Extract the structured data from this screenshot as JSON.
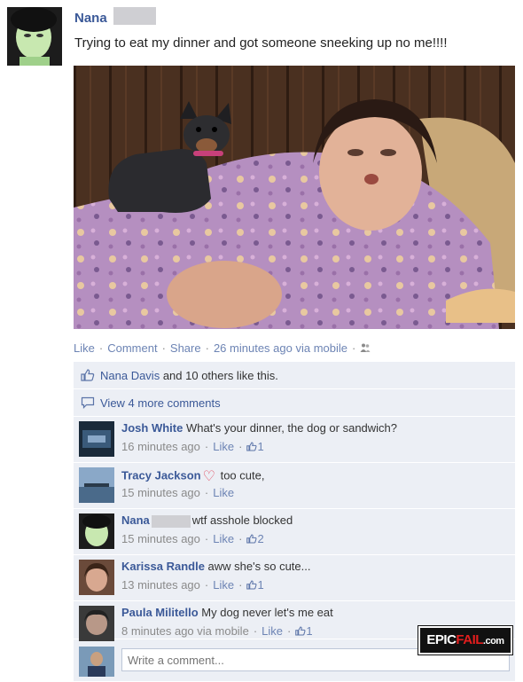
{
  "post": {
    "author": "Nana",
    "text": "Trying to eat my dinner and got someone sneeking up no me!!!!"
  },
  "actions": {
    "like": "Like",
    "comment": "Comment",
    "share": "Share",
    "time": "26 minutes ago via mobile",
    "separator": "·"
  },
  "likes": {
    "first": "Nana Davis",
    "rest": " and 10 others like this."
  },
  "view_more": "View 4 more comments",
  "comments": [
    {
      "name": "Josh White",
      "text": " What's your dinner, the dog or sandwich?",
      "time": "16 minutes ago",
      "like": "Like",
      "likes": "1"
    },
    {
      "name": "Tracy Jackson",
      "text": " too cute,",
      "time": "15 minutes ago",
      "like": "Like"
    },
    {
      "name": "Nana",
      "text": "wtf asshole blocked",
      "time": "15 minutes ago",
      "like": "Like",
      "likes": "2"
    },
    {
      "name": "Karissa Randle",
      "text": " aww she's so cute...",
      "time": "13 minutes ago",
      "like": "Like",
      "likes": "1"
    },
    {
      "name": "Paula Militello",
      "text": " My dog never let's me eat",
      "time": "8 minutes ago via mobile",
      "like": "Like",
      "likes": "1"
    }
  ],
  "write_placeholder": "Write a comment...",
  "watermark": {
    "a": "EPIC",
    "b": "FAIL",
    "c": ".com"
  },
  "colors": {
    "link": "#3b5998",
    "meta_link": "#6d84b4",
    "comment_bg": "#eceff5",
    "heart": "#e0475c"
  },
  "icons": [
    "thumbs-up-icon",
    "speech-bubble-icon",
    "friends-icon",
    "heart-icon"
  ]
}
